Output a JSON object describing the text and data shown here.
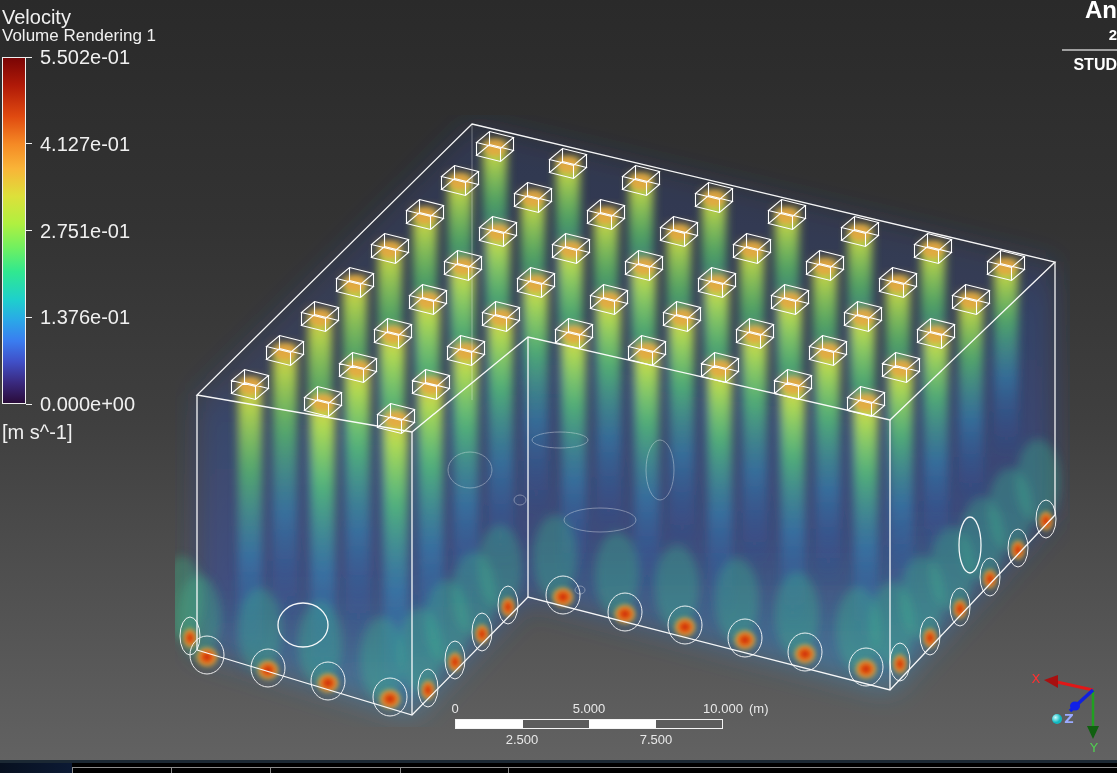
{
  "legend": {
    "variable": "Velocity",
    "plot": "Volume Rendering 1",
    "ticks": [
      "5.502e-01",
      "4.127e-01",
      "2.751e-01",
      "1.376e-01",
      "0.000e+00"
    ],
    "units": "[m s^-1]"
  },
  "logo": {
    "brand": "An",
    "version": "2",
    "edition": "STUD"
  },
  "scale_bar": {
    "top_labels": [
      "0",
      "5.000",
      "10.000"
    ],
    "unit": "(m)",
    "bottom_labels": [
      "2.500",
      "7.500"
    ]
  },
  "axis_triad": {
    "x": "X",
    "y": "Y",
    "z": "Z"
  },
  "bottom_tabs": [
    {
      "selected": true
    },
    {
      "selected": false
    },
    {
      "selected": false
    },
    {
      "selected": false
    },
    {
      "selected": false
    },
    {
      "selected": false
    }
  ]
}
